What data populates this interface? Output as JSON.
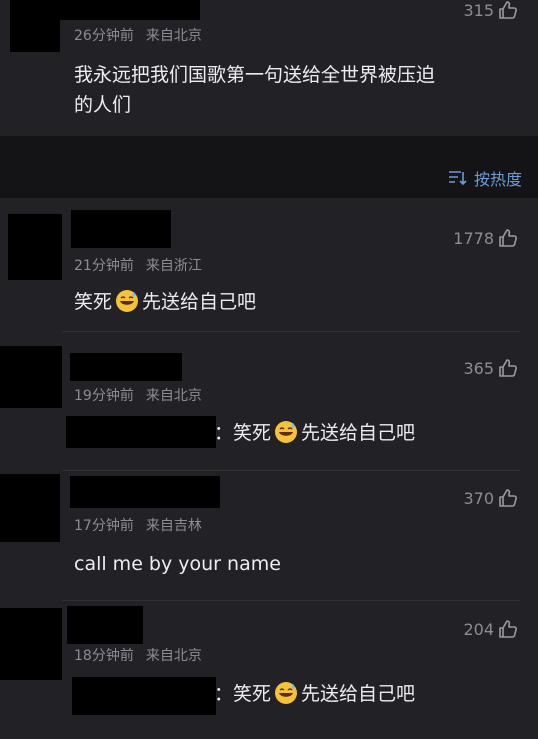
{
  "top_comment": {
    "time": "26分钟前",
    "location": "来自北京",
    "likes": "315",
    "text_line1": "我永远把我们国歌第一句送给全世界被压迫",
    "text_line2": "的人们"
  },
  "sort": {
    "label": "按热度",
    "icon": "sort-icon"
  },
  "comments": [
    {
      "time": "21分钟前",
      "location": "来自浙江",
      "likes": "1778",
      "text_a": "笑死",
      "text_b": "先送给自己吧",
      "emoji": "grinning-sweat-emoji"
    },
    {
      "time": "19分钟前",
      "location": "来自北京",
      "likes": "365",
      "reply_sep": "：",
      "text_a": "笑死",
      "text_b": "先送给自己吧",
      "emoji": "grinning-sweat-emoji"
    },
    {
      "time": "17分钟前",
      "location": "来自吉林",
      "likes": "370",
      "text": "call me by your name"
    },
    {
      "time": "18分钟前",
      "location": "来自北京",
      "likes": "204",
      "reply_sep": "：",
      "text_a": "笑死",
      "text_b": "先送给自己吧",
      "emoji": "grinning-sweat-emoji"
    }
  ],
  "colors": {
    "background": "#141416",
    "card": "#222226",
    "accent": "#6d9bd8",
    "muted": "#8c8c94"
  }
}
